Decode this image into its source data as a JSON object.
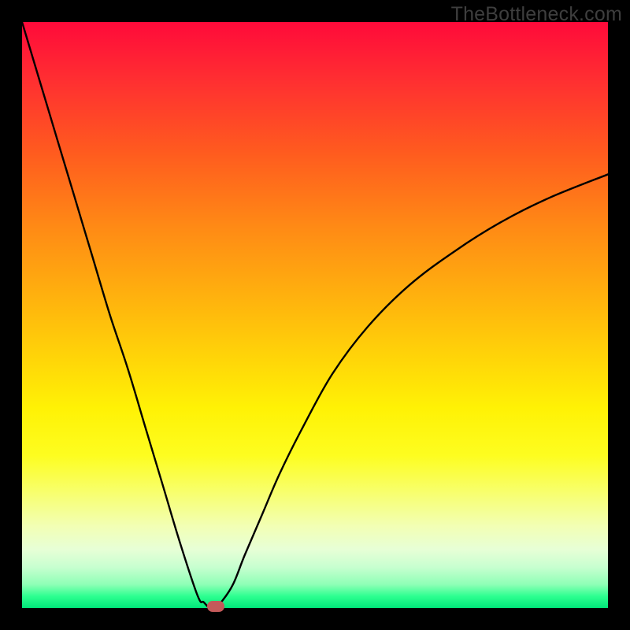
{
  "watermark": "TheBottleneck.com",
  "colors": {
    "frame": "#000000",
    "curve": "#000000",
    "marker": "#c55a5a",
    "gradient_top": "#ff0a3a",
    "gradient_bottom": "#00e77a"
  },
  "chart_data": {
    "type": "line",
    "title": "",
    "xlabel": "",
    "ylabel": "",
    "xlim": [
      0,
      100
    ],
    "ylim": [
      0,
      100
    ],
    "grid": false,
    "legend": false,
    "series": [
      {
        "name": "bottleneck-curve",
        "x": [
          0,
          3,
          6,
          9,
          12,
          15,
          18,
          21,
          24,
          27,
          30,
          31,
          32,
          33,
          34,
          36,
          38,
          41,
          44,
          48,
          53,
          59,
          66,
          74,
          82,
          90,
          100
        ],
        "values": [
          100,
          90,
          80,
          70,
          60,
          50,
          41,
          31,
          21,
          11,
          2,
          1,
          0,
          0,
          1,
          4,
          9,
          16,
          23,
          31,
          40,
          48,
          55,
          61,
          66,
          70,
          74
        ]
      }
    ],
    "annotations": [
      {
        "name": "optimal-marker",
        "x": 33,
        "y": 0,
        "shape": "rounded-rect",
        "color": "#c55a5a"
      }
    ],
    "background": "vertical-gradient red→green"
  }
}
